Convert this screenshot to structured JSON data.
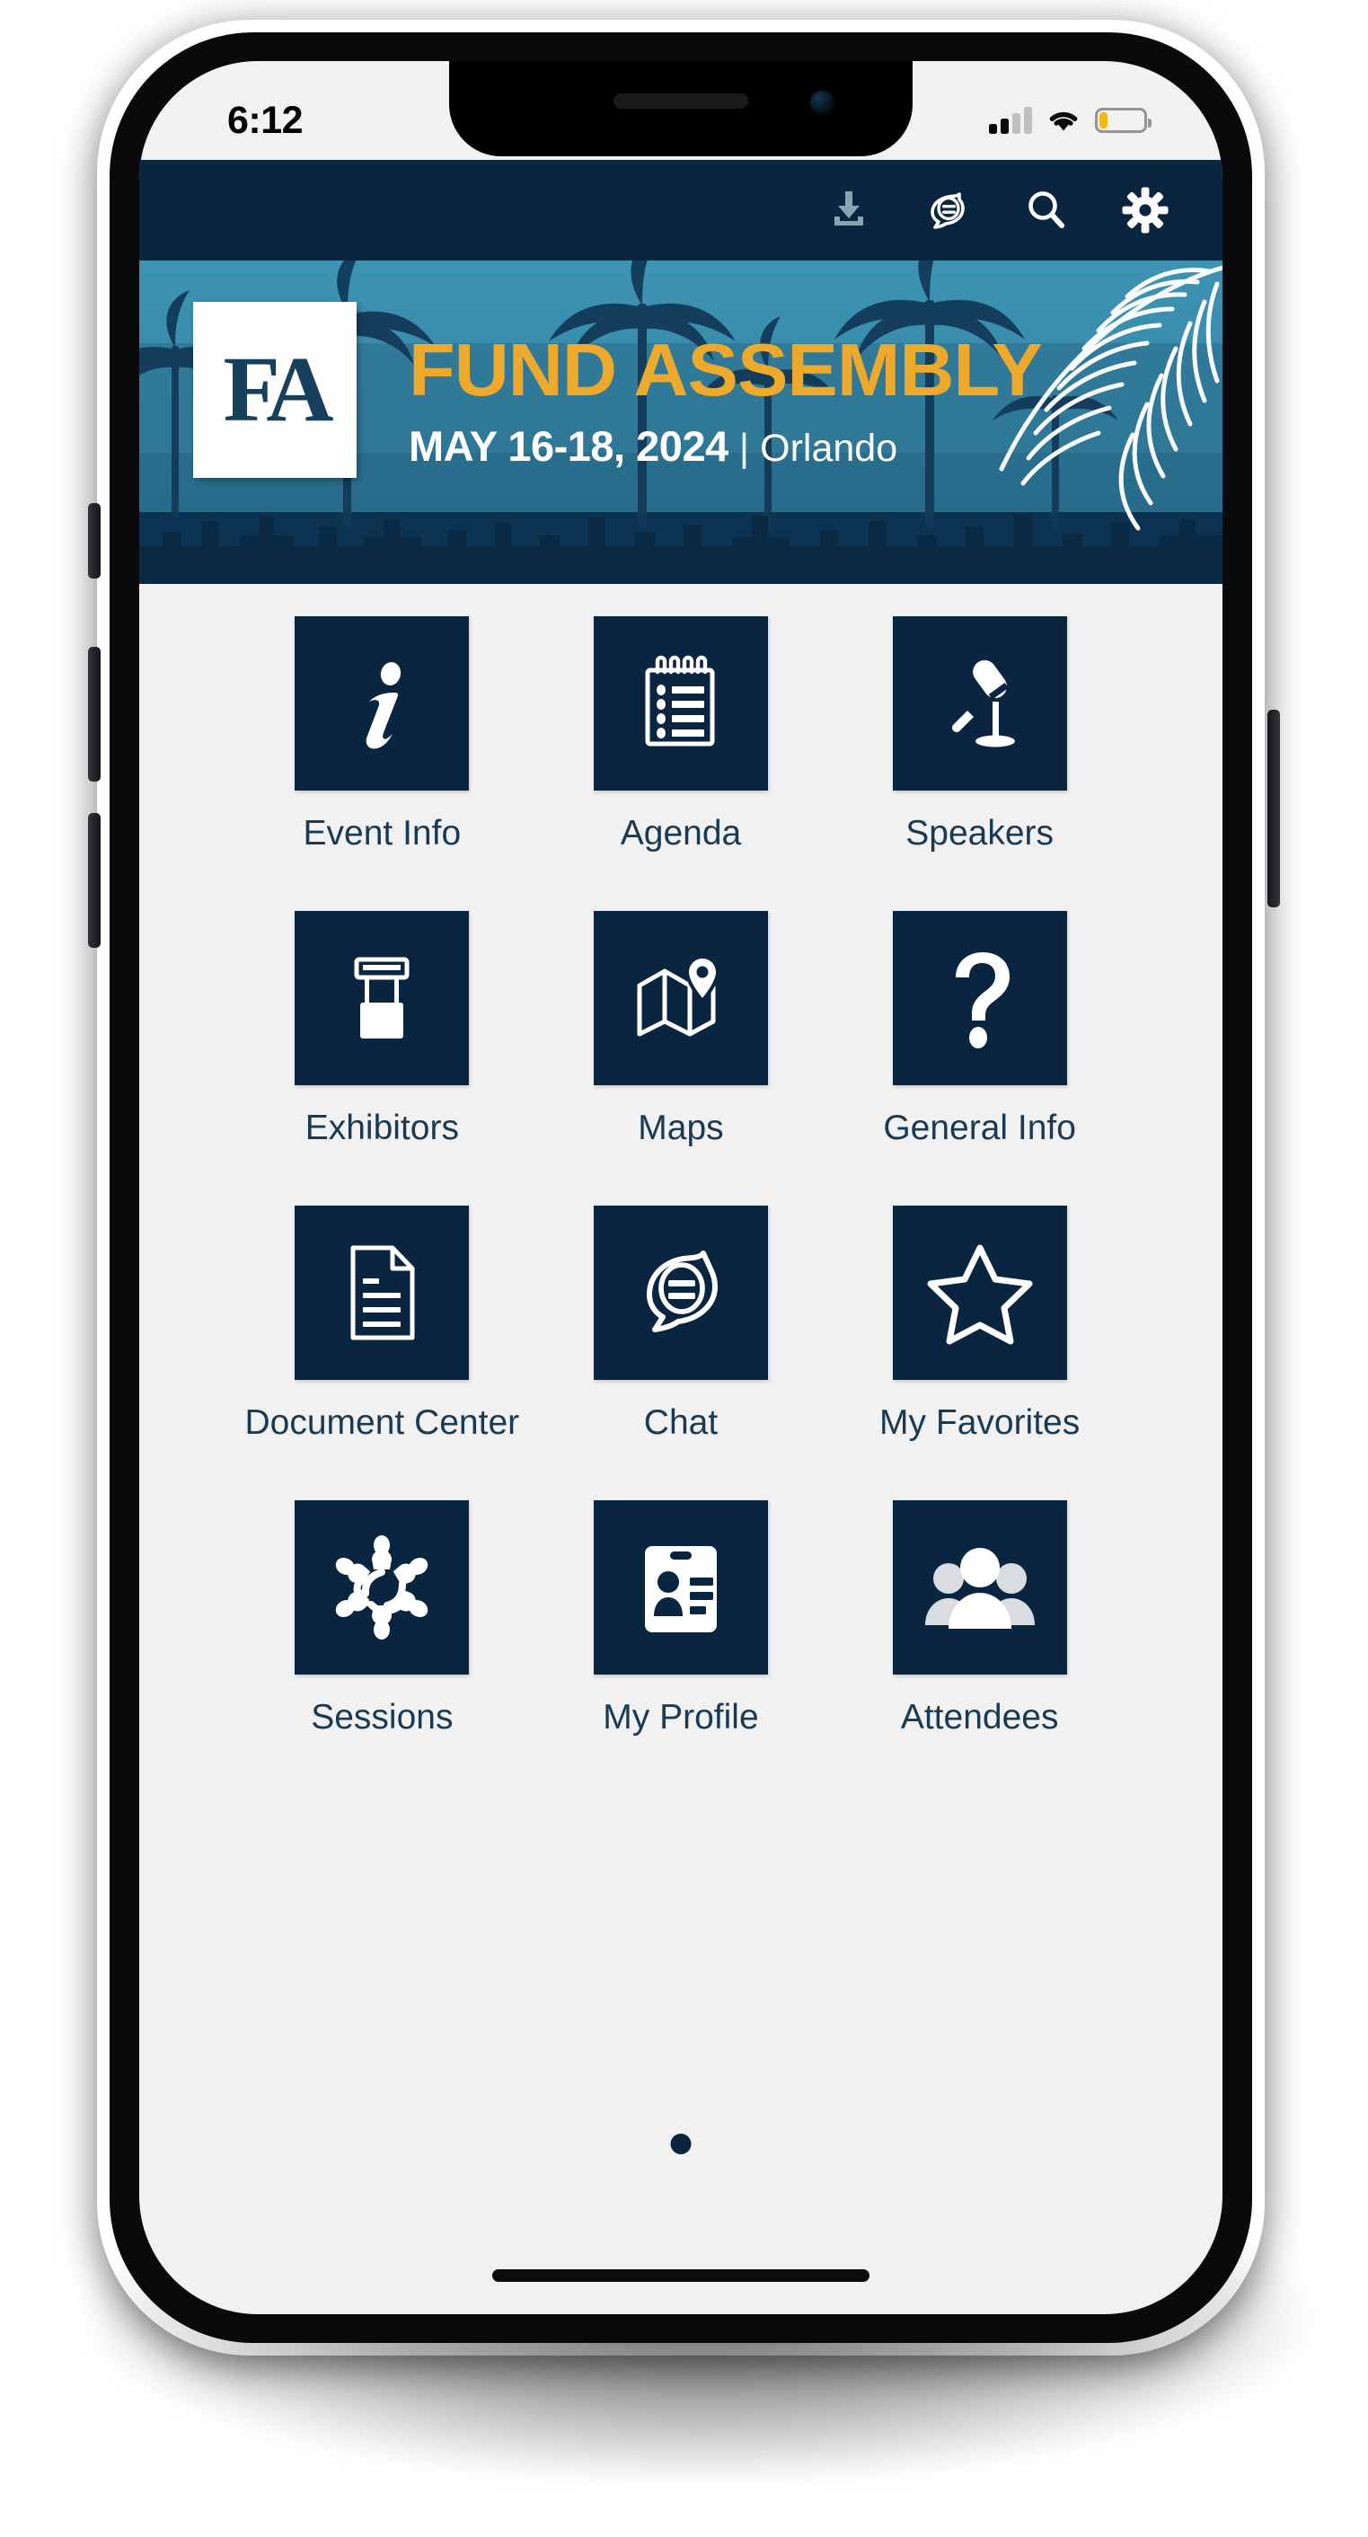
{
  "status_bar": {
    "time": "6:12",
    "cellular_icon": "cellular-signal-icon",
    "cellular_bars_filled": 2,
    "cellular_bars_total": 4,
    "wifi_icon": "wifi-icon",
    "battery_icon": "battery-icon",
    "battery_level_percent": 18,
    "battery_color": "#f5b711"
  },
  "toolbar": {
    "background_color": "#0a2540",
    "items": [
      {
        "name": "download-icon",
        "label": "Download",
        "state": "disabled",
        "color": "#8ba2b5"
      },
      {
        "name": "chat-icon",
        "label": "Chat",
        "state": "enabled",
        "color": "#ffffff"
      },
      {
        "name": "search-icon",
        "label": "Search",
        "state": "enabled",
        "color": "#ffffff"
      },
      {
        "name": "settings-gear-icon",
        "label": "Settings",
        "state": "enabled",
        "color": "#ffffff"
      }
    ]
  },
  "banner": {
    "logo_text": "FA",
    "title": "FUND ASSEMBLY",
    "date": "MAY 16-18, 2024",
    "separator": "|",
    "city": "Orlando",
    "title_color": "#eda92b",
    "text_color": "#ffffff",
    "sky_color": "#3a8fb0",
    "deep_color": "#0a2a44"
  },
  "grid": {
    "tile_background": "#0a2540",
    "label_color": "#1a3a54",
    "tiles": [
      {
        "label": "Event Info",
        "icon": "info-italic-i-icon"
      },
      {
        "label": "Agenda",
        "icon": "notepad-checklist-icon"
      },
      {
        "label": "Speakers",
        "icon": "microphone-stand-icon"
      },
      {
        "label": "Exhibitors",
        "icon": "exhibit-booth-stand-icon"
      },
      {
        "label": "Maps",
        "icon": "folded-map-pin-icon"
      },
      {
        "label": "General Info",
        "icon": "question-mark-icon"
      },
      {
        "label": "Document Center",
        "icon": "document-page-icon"
      },
      {
        "label": "Chat",
        "icon": "chat-bubbles-icon"
      },
      {
        "label": "My Favorites",
        "icon": "star-outline-icon"
      },
      {
        "label": "Sessions",
        "icon": "people-network-icon"
      },
      {
        "label": "My Profile",
        "icon": "id-badge-card-icon"
      },
      {
        "label": "Attendees",
        "icon": "group-people-icon"
      }
    ]
  },
  "footer": {
    "page_indicator_icon": "page-dot-indicator",
    "page_current": 1,
    "home_indicator_icon": "home-indicator-bar"
  }
}
